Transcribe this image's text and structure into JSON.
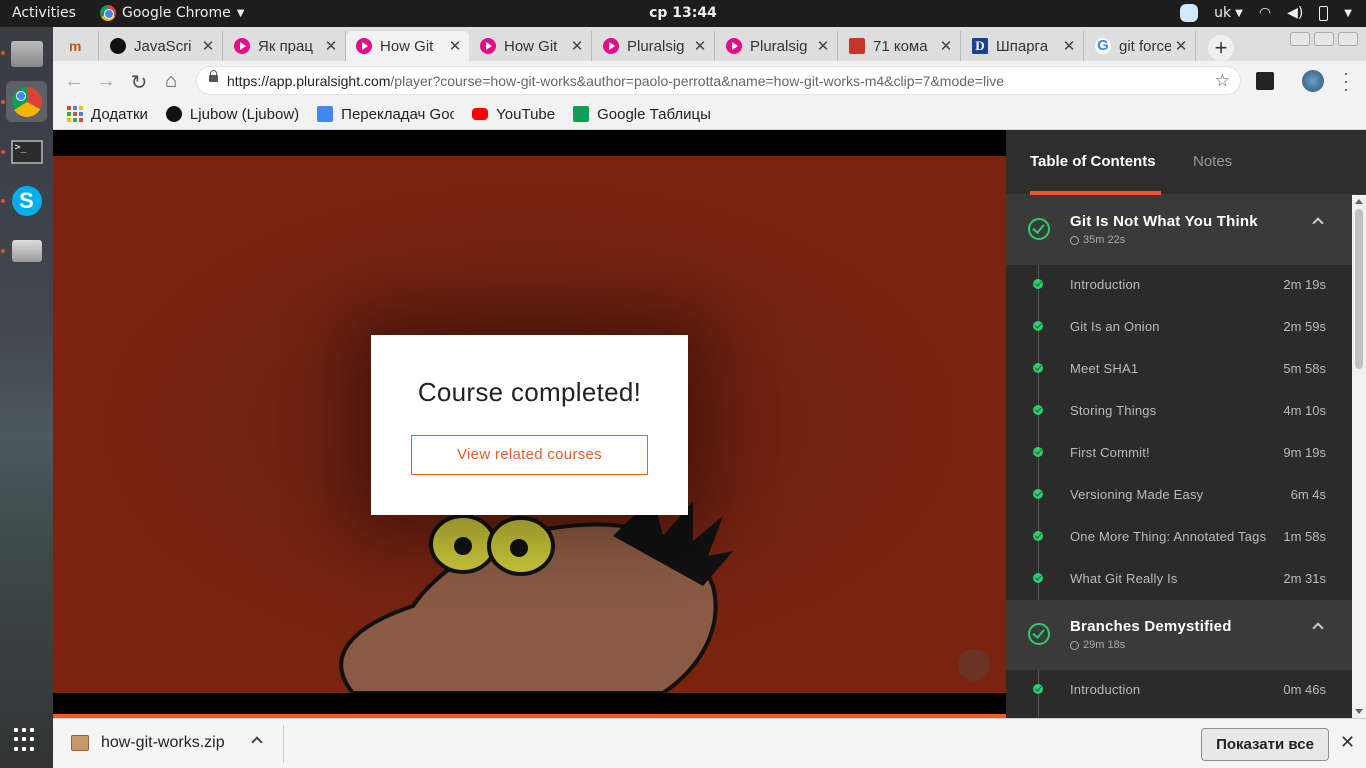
{
  "system": {
    "activities": "Activities",
    "app_name": "Google Chrome",
    "clock": "ср 13:44",
    "lang": "uk"
  },
  "tabs": [
    {
      "title": "",
      "icon": "moodle-icon"
    },
    {
      "title": "JavaScri",
      "icon": "github-icon"
    },
    {
      "title": "Як прац",
      "icon": "pluralsight-icon"
    },
    {
      "title": "How Git",
      "icon": "pluralsight-icon",
      "active": true
    },
    {
      "title": "How Git",
      "icon": "pluralsight-icon"
    },
    {
      "title": "Pluralsig",
      "icon": "pluralsight-icon"
    },
    {
      "title": "Pluralsig",
      "icon": "pluralsight-icon"
    },
    {
      "title": "71 кома",
      "icon": "habr-icon"
    },
    {
      "title": "Шпарга",
      "icon": "d-icon"
    },
    {
      "title": "git force",
      "icon": "google-icon"
    }
  ],
  "address": {
    "host": "https://app.pluralsight.com",
    "path": "/player?course=how-git-works&author=paolo-perrotta&name=how-git-works-m4&clip=7&mode=live"
  },
  "bookmarks": [
    {
      "label": "Додатки"
    },
    {
      "label": "Ljubow (Ljubow)"
    },
    {
      "label": "Перекладач Goo"
    },
    {
      "label": "YouTube"
    },
    {
      "label": "Google Таблицы"
    }
  ],
  "player": {
    "modal_title": "Course completed!",
    "modal_button": "View related courses",
    "progress": 1.0
  },
  "sidebar": {
    "tab_toc": "Table of Contents",
    "tab_notes": "Notes",
    "modules": [
      {
        "title": "Git Is Not What You Think",
        "duration": "35m 22s",
        "clips": [
          {
            "title": "Introduction",
            "duration": "2m 19s"
          },
          {
            "title": "Git Is an Onion",
            "duration": "2m 59s"
          },
          {
            "title": "Meet SHA1",
            "duration": "5m 58s"
          },
          {
            "title": "Storing Things",
            "duration": "4m 10s"
          },
          {
            "title": "First Commit!",
            "duration": "9m 19s"
          },
          {
            "title": "Versioning Made Easy",
            "duration": "6m 4s"
          },
          {
            "title": "One More Thing: Annotated Tags",
            "duration": "1m 58s"
          },
          {
            "title": "What Git Really Is",
            "duration": "2m 31s"
          }
        ]
      },
      {
        "title": "Branches Demystified",
        "duration": "29m 18s",
        "clips": [
          {
            "title": "Introduction",
            "duration": "0m 46s"
          }
        ]
      }
    ]
  },
  "downloads": {
    "file": "how-git-works.zip",
    "show_all": "Показати все"
  },
  "colors": {
    "accent": "#f05a28",
    "complete": "#2ecc71",
    "video_bg": "#7a2410"
  }
}
